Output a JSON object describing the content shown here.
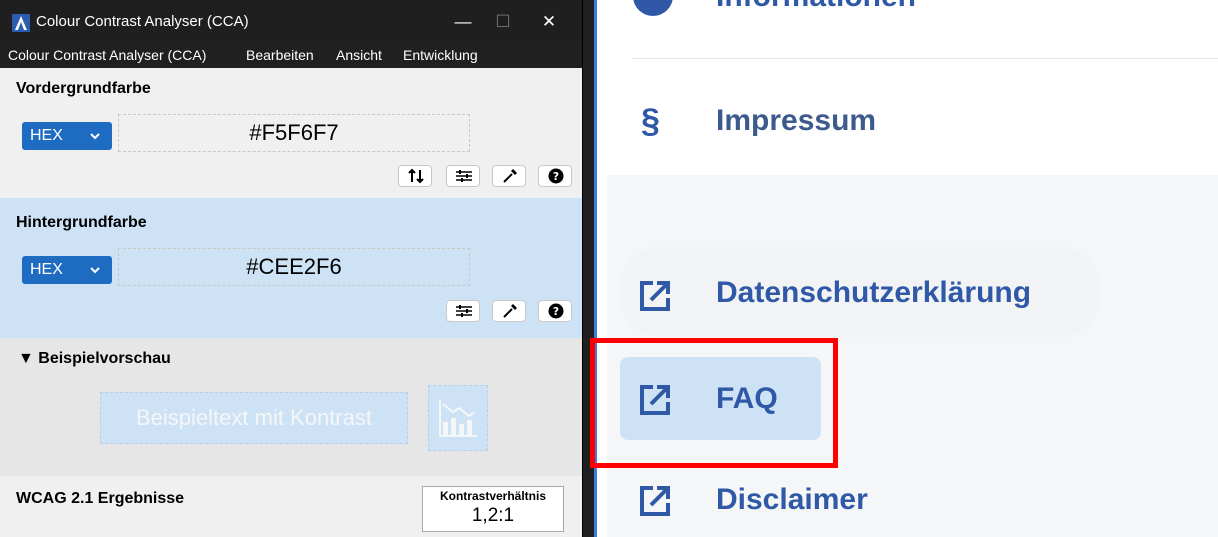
{
  "window": {
    "title": "Colour Contrast Analyser (CCA)",
    "controls": {
      "minimize": "—",
      "maximize": "☐",
      "close": "✕"
    }
  },
  "menu": [
    "Colour Contrast Analyser (CCA)",
    "Bearbeiten",
    "Ansicht",
    "Entwicklung"
  ],
  "foreground": {
    "title": "Vordergrundfarbe",
    "format": "HEX",
    "value": "#F5F6F7",
    "tools": [
      "swap-icon",
      "sliders-icon",
      "eyedropper-icon",
      "help-icon"
    ]
  },
  "background": {
    "title": "Hintergrundfarbe",
    "format": "HEX",
    "value": "#CEE2F6",
    "tools": [
      "sliders-icon",
      "eyedropper-icon",
      "help-icon"
    ]
  },
  "preview": {
    "title": "▼ Beispielvorschau",
    "sample_text": "Beispieltext mit Kontrast"
  },
  "results": {
    "title": "WCAG 2.1 Ergebnisse",
    "ratio_label": "Kontrastverhältnis",
    "ratio_value": "1,2:1"
  },
  "site": {
    "nav": {
      "info": "Informationen",
      "impressum_icon": "§",
      "impressum": "Impressum",
      "datenschutz": "Datenschutzerklärung",
      "faq": "FAQ",
      "disclaimer": "Disclaimer"
    }
  },
  "colors": {
    "foreground": "#F5F6F7",
    "background": "#CEE2F6",
    "accent": "#1e6bc2",
    "nav_text": "#2f58a7",
    "highlight": "#ff0000"
  }
}
